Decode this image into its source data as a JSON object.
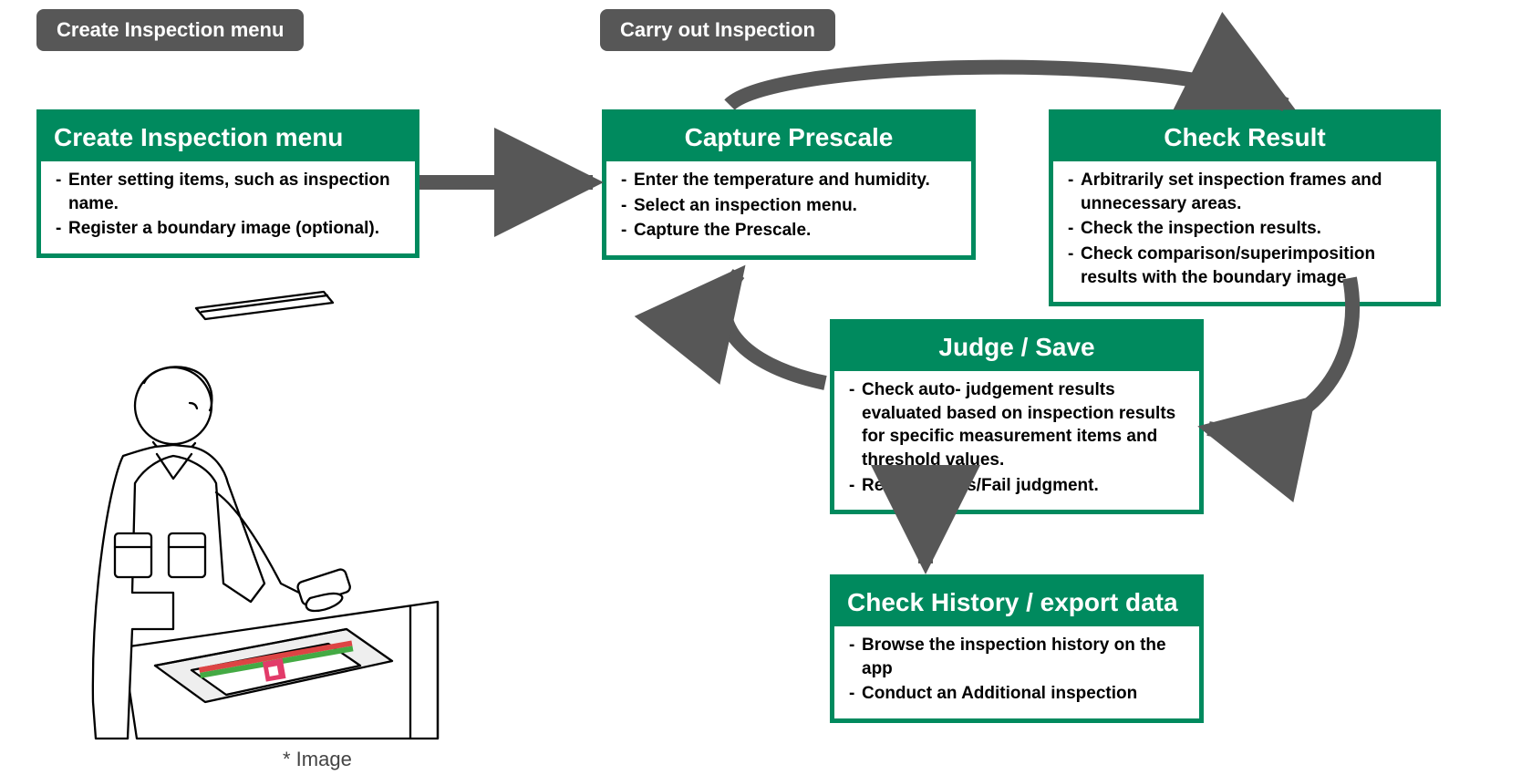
{
  "sections": {
    "left_label": "Create Inspection menu",
    "right_label": "Carry out Inspection"
  },
  "cards": {
    "create": {
      "title": "Create Inspection menu",
      "b1": "Enter setting items, such as inspection name.",
      "b2": "Register a boundary image (optional)."
    },
    "capture": {
      "title": "Capture Prescale",
      "b1": "Enter the temperature and humidity.",
      "b2": "Select an inspection menu.",
      "b3": "Capture the Prescale."
    },
    "check": {
      "title": "Check Result",
      "b1": "Arbitrarily set inspection frames and unnecessary areas.",
      "b2": "Check the inspection results.",
      "b3": "Check comparison/superimposition results with the boundary image."
    },
    "judge": {
      "title": "Judge / Save",
      "b1": "Check auto- judgement results evaluated based on inspection results for specific measurement items and threshold values.",
      "b2": "Register Pass/Fail judgment."
    },
    "history": {
      "title": "Check History / export data",
      "b1": "Browse the inspection history on the app",
      "b2": "Conduct an Additional inspection"
    }
  },
  "caption": "*  Image",
  "colors": {
    "accent": "#008a5e",
    "arrow": "#575757"
  }
}
